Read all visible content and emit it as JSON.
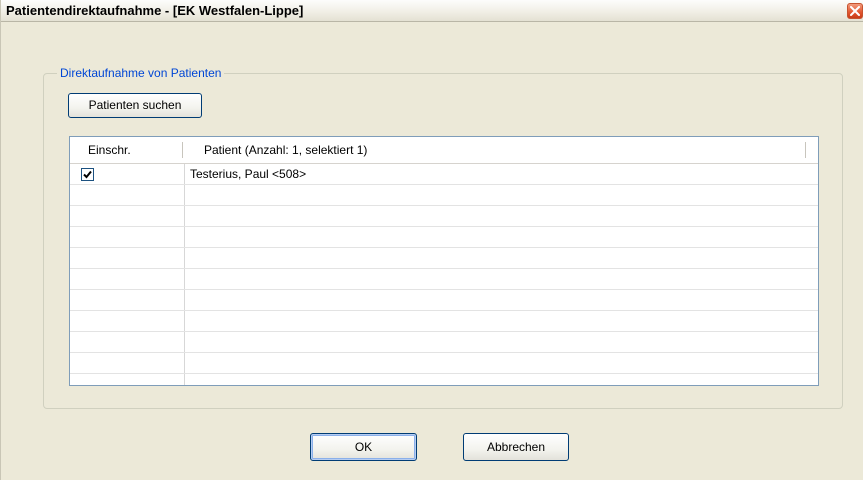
{
  "window": {
    "title": "Patientendirektaufnahme - [EK Westfalen-Lippe]"
  },
  "group": {
    "label": "Direktaufnahme von Patienten"
  },
  "buttons": {
    "search": "Patienten suchen",
    "ok": "OK",
    "cancel": "Abbrechen"
  },
  "table": {
    "columns": [
      "Einschr.",
      "Patient (Anzahl: 1, selektiert 1)"
    ],
    "rows": [
      {
        "checked": true,
        "patient": "Testerius,  Paul <508>"
      }
    ]
  },
  "icons": {
    "close": "close-icon",
    "check": "checkmark-icon"
  }
}
